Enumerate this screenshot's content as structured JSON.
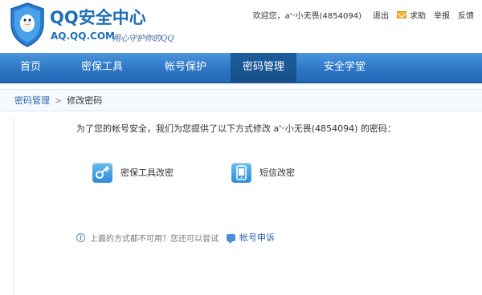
{
  "brand": {
    "title": "QQ安全中心",
    "domain": "AQ.QQ.COM",
    "slogan": "用心守护你的QQ"
  },
  "toplinks": {
    "welcome": "欢迎您，a'ᵕ小无畏(4854094)",
    "logout": "退出",
    "help": "求助",
    "report": "举报",
    "feedback": "反馈"
  },
  "nav": {
    "items": [
      {
        "label": "首页"
      },
      {
        "label": "密保工具"
      },
      {
        "label": "帐号保护"
      },
      {
        "label": "密码管理"
      },
      {
        "label": "安全学堂"
      }
    ],
    "active_index": 3
  },
  "breadcrumb": {
    "parent": "密码管理",
    "separator": ">",
    "current": "修改密码"
  },
  "content": {
    "intro": "为了您的帐号安全，我们为您提供了以下方式修改 a'ᵕ小无畏(4854094) 的密码：",
    "options": [
      {
        "label": "密保工具改密",
        "icon": "key-icon"
      },
      {
        "label": "短信改密",
        "icon": "phone-icon"
      }
    ],
    "fallback_text": "上面的方式都不可用？您还可以尝试",
    "appeal_label": "帐号申诉"
  },
  "colors": {
    "brand_blue": "#1e6fb8",
    "nav_blue": "#2d77c6",
    "nav_active": "#1a5795",
    "link_blue": "#2a65aa"
  }
}
